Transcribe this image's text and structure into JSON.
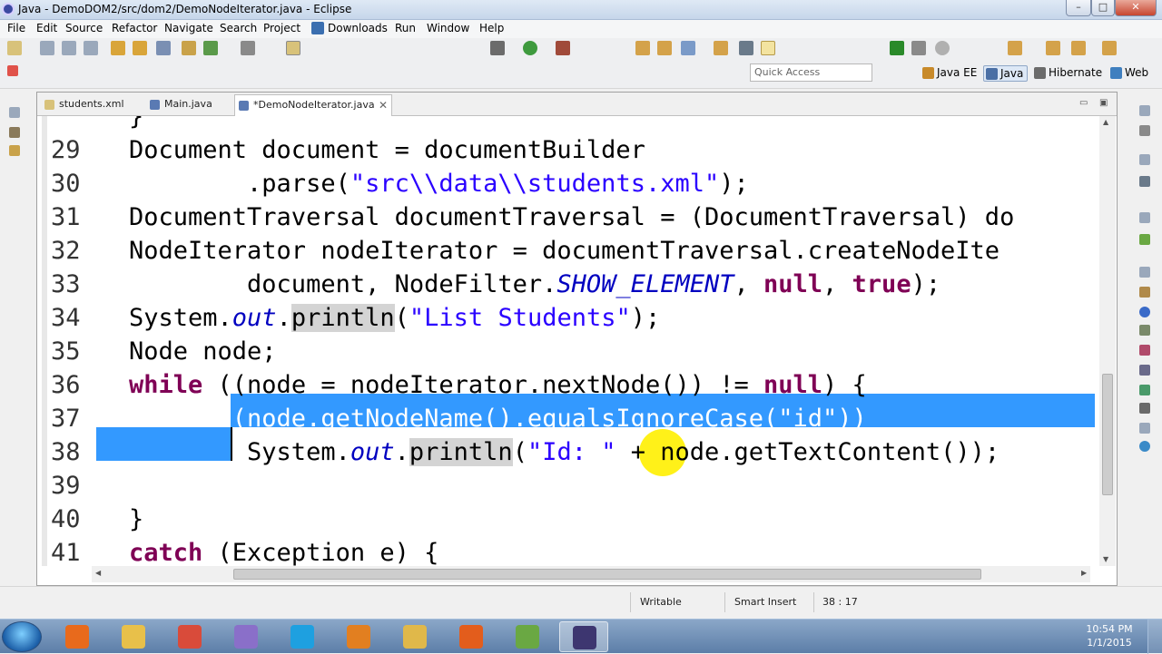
{
  "window": {
    "title": "Java - DemoDOM2/src/dom2/DemoNodeIterator.java - Eclipse",
    "min": "–",
    "max": "□",
    "close": "✕"
  },
  "menu": [
    "File",
    "Edit",
    "Source",
    "Refactor",
    "Navigate",
    "Search",
    "Project",
    "Downloads",
    "Run",
    "Window",
    "Help"
  ],
  "toolbar": {
    "quick_access": "Quick Access"
  },
  "perspectives": [
    {
      "label": "Java EE",
      "color": "#c88a2a"
    },
    {
      "label": "Java",
      "color": "#4a6fa5"
    },
    {
      "label": "Hibernate",
      "color": "#6b6b6b"
    },
    {
      "label": "Web",
      "color": "#3f7fbf"
    }
  ],
  "tabs": [
    {
      "label": "students.xml"
    },
    {
      "label": "Main.java"
    },
    {
      "label": "*DemoNodeIterator.java"
    }
  ],
  "code": {
    "partial_line": "}",
    "lines": [
      {
        "n": "29",
        "parts": [
          [
            "Document document = documentBuilder",
            ""
          ]
        ]
      },
      {
        "n": "30",
        "parts": [
          [
            "        .parse(",
            ""
          ],
          [
            "\"src\\\\data\\\\students.xml\"",
            "st"
          ],
          [
            ");",
            ""
          ]
        ]
      },
      {
        "n": "31",
        "parts": [
          [
            "DocumentTraversal documentTraversal = (DocumentTraversal) do",
            ""
          ]
        ]
      },
      {
        "n": "32",
        "parts": [
          [
            "NodeIterator nodeIterator = documentTraversal.createNodeIte",
            ""
          ]
        ]
      },
      {
        "n": "33",
        "parts": [
          [
            "        document, NodeFilter.",
            ""
          ],
          [
            "SHOW_ELEMENT",
            "it"
          ],
          [
            ", ",
            ""
          ],
          [
            "null",
            "kw"
          ],
          [
            ", ",
            ""
          ],
          [
            "true",
            "kw"
          ],
          [
            ");",
            ""
          ]
        ]
      },
      {
        "n": "34",
        "parts": [
          [
            "System.",
            ""
          ],
          [
            "out",
            "it"
          ],
          [
            ".",
            ""
          ],
          [
            "println",
            "mh"
          ],
          [
            "(",
            ""
          ],
          [
            "\"List Students\"",
            "st"
          ],
          [
            ");",
            ""
          ]
        ]
      },
      {
        "n": "35",
        "parts": [
          [
            "Node node;",
            ""
          ]
        ]
      },
      {
        "n": "36",
        "parts": [
          [
            "while",
            "kw"
          ],
          [
            " ((node = nodeIterator.nextNode()) != ",
            ""
          ],
          [
            "null",
            "kw"
          ],
          [
            ") {",
            ""
          ]
        ]
      },
      {
        "n": "37",
        "parts": [
          [
            "    if (node.getNodeName().equalsIgnoreCase(\"id\"))",
            "sel"
          ]
        ]
      },
      {
        "n": "38",
        "parts": [
          [
            "        System.",
            ""
          ],
          [
            "out",
            "it"
          ],
          [
            ".",
            ""
          ],
          [
            "println",
            "mh"
          ],
          [
            "(",
            ""
          ],
          [
            "\"Id: \"",
            "st"
          ],
          [
            " + node.getTextContent());",
            ""
          ]
        ]
      },
      {
        "n": "39",
        "parts": [
          [
            "",
            ""
          ]
        ]
      },
      {
        "n": "40",
        "parts": [
          [
            "}",
            ""
          ]
        ]
      },
      {
        "n": "41",
        "parts": [
          [
            "catch",
            "kw"
          ],
          [
            " (Exception e) {",
            ""
          ]
        ]
      }
    ]
  },
  "status": {
    "writable": "Writable",
    "insert": "Smart Insert",
    "position": "38 : 17"
  },
  "taskbar": {
    "time": "10:54 PM",
    "date": "1/1/2015",
    "apps": [
      {
        "name": "windows-media-player",
        "color": "#e86a1c"
      },
      {
        "name": "file-explorer-library",
        "color": "#e8c04a"
      },
      {
        "name": "chrome",
        "color": "#d94b3a"
      },
      {
        "name": "messenger",
        "color": "#8a6fc9"
      },
      {
        "name": "skype",
        "color": "#1ea0e0"
      },
      {
        "name": "outlook-powerpoint",
        "color": "#e27f20"
      },
      {
        "name": "windows-explorer",
        "color": "#e0b84a"
      },
      {
        "name": "firefox",
        "color": "#e35d1c"
      },
      {
        "name": "notepad-plus-plus",
        "color": "#6aa843"
      },
      {
        "name": "eclipse-java-ee",
        "color": "#3d3670"
      }
    ]
  }
}
